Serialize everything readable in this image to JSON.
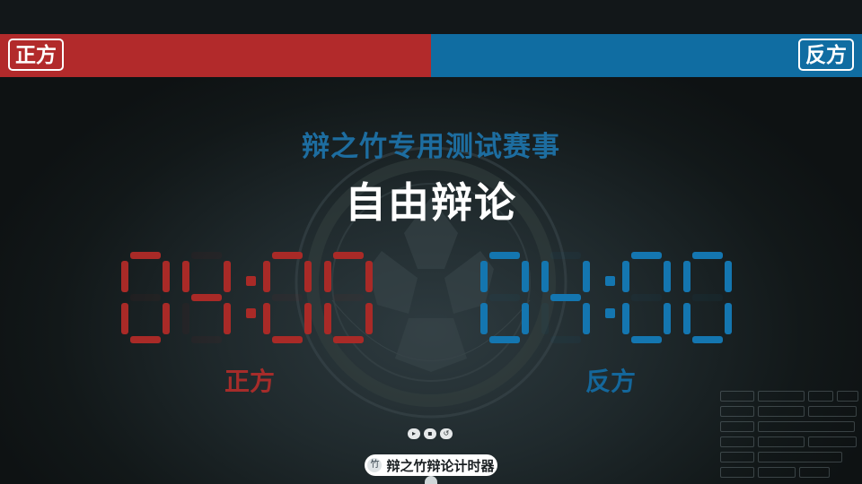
{
  "affirmative": {
    "header_tag": "正方",
    "time": "04:00",
    "label": "正方",
    "color": "#b22a2b",
    "digit_color": "#a92a27"
  },
  "negative": {
    "header_tag": "反方",
    "time": "04:00",
    "label": "反方",
    "color": "#106da2",
    "digit_color": "#1476b0"
  },
  "event_title": "辩之竹专用测试赛事",
  "stage_title": "自由辩论",
  "controls": [
    {
      "name": "play-button",
      "icon": "play-icon",
      "glyph": "▸"
    },
    {
      "name": "pause-button",
      "icon": "pause-icon",
      "glyph": "▪"
    },
    {
      "name": "reset-button",
      "icon": "reset-icon",
      "glyph": "↺"
    }
  ],
  "brand": {
    "name": "辩之竹辩论计时器",
    "logo_icon": "bamboo-logo-icon",
    "logo_glyph": "竹"
  },
  "watermark_icon": "academy-emblem-icon"
}
